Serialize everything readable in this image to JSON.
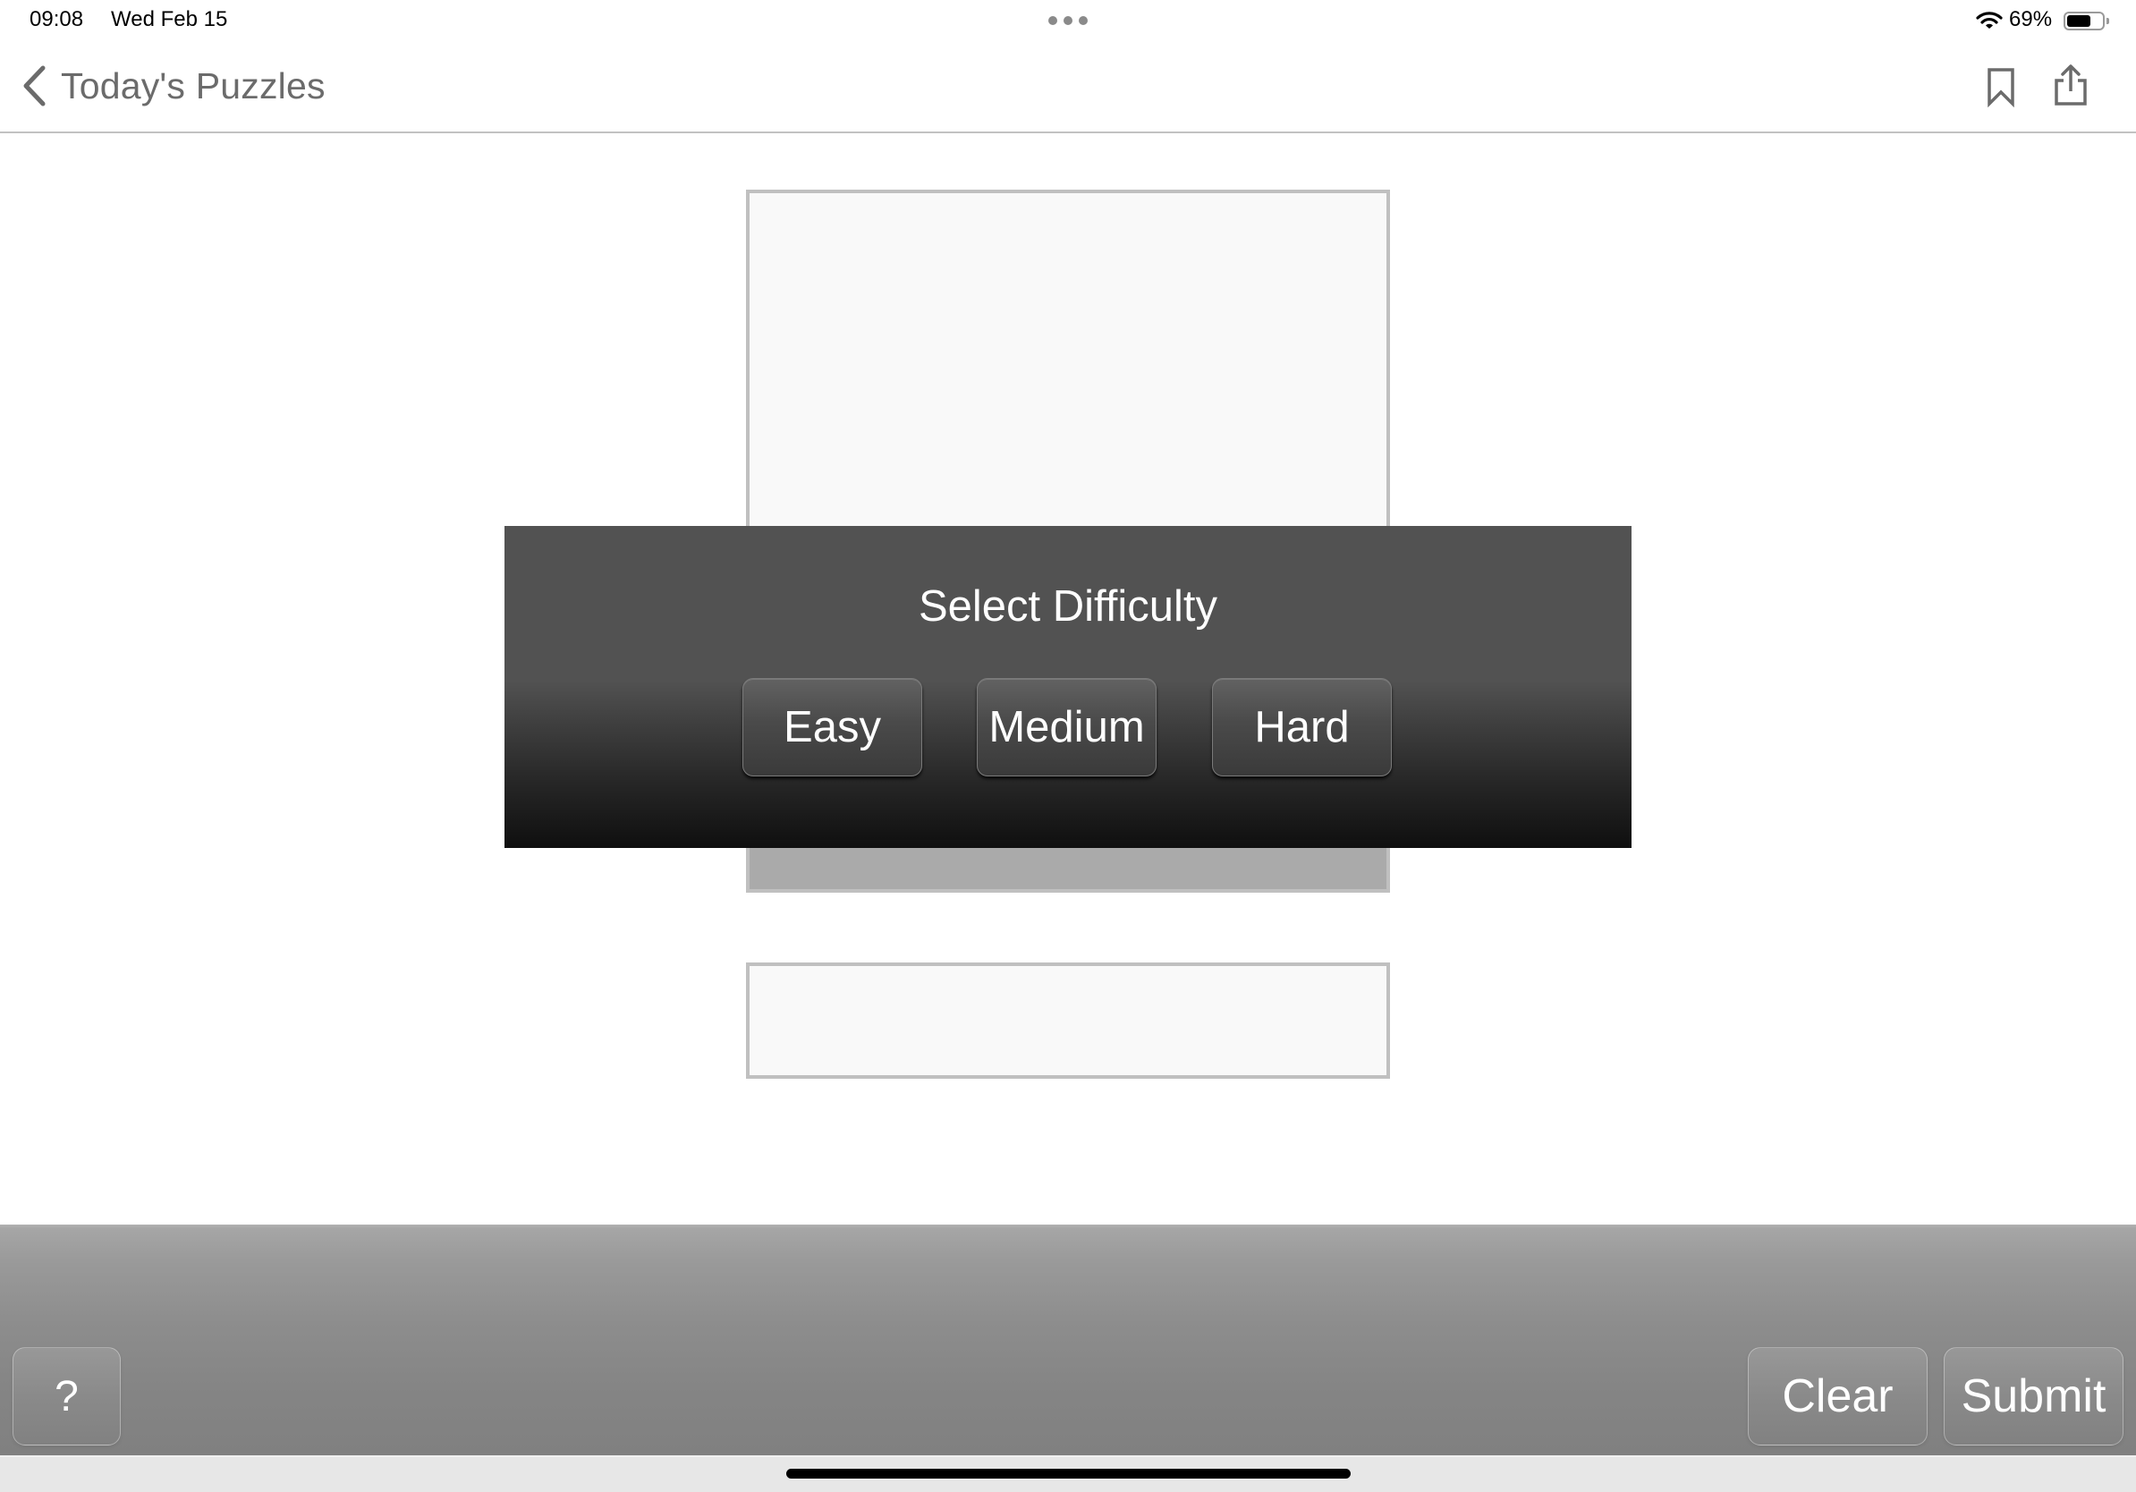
{
  "status_bar": {
    "time": "09:08",
    "date": "Wed Feb 15",
    "battery_percent_label": "69%",
    "battery_level": 0.69,
    "icons": [
      "multitasking-dots-icon",
      "wifi-icon",
      "battery-icon"
    ]
  },
  "nav_bar": {
    "back_label": "Today's Puzzles",
    "back_icon": "chevron-left-icon",
    "actions": [
      {
        "name": "bookmark",
        "icon": "bookmark-icon"
      },
      {
        "name": "share",
        "icon": "share-icon"
      }
    ]
  },
  "modal": {
    "title": "Select Difficulty",
    "options": [
      {
        "label": "Easy"
      },
      {
        "label": "Medium"
      },
      {
        "label": "Hard"
      }
    ]
  },
  "toolbar": {
    "help_label": "?",
    "clear_label": "Clear",
    "submit_label": "Submit"
  },
  "colors": {
    "modal_background": "#525252",
    "toolbar_background": "#8d8d8d",
    "nav_text": "#6b6b6b",
    "puzzle_border": "#c0c0c0"
  }
}
